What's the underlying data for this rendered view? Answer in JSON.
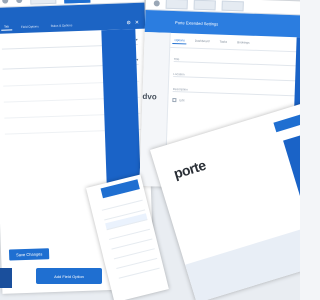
{
  "left_panel": {
    "tabs": [
      "Tab",
      "Field Options",
      "Rules & Options"
    ],
    "fields": [
      "",
      ""
    ],
    "note": "",
    "rows": [
      "",
      "",
      "",
      ""
    ],
    "action_button": "Save Changes"
  },
  "right_panel": {
    "title": "Porte Extended Settings",
    "tabs": [
      "Options",
      "Dashboard",
      "Tasks",
      "Bookings"
    ],
    "brand": "dvo",
    "fields": [
      "Title",
      "Location",
      "Description"
    ],
    "checkbox_label": "Edit"
  },
  "device": {
    "logo": "porte"
  },
  "phone": {
    "items": [
      "",
      "",
      "",
      "",
      "",
      "",
      "",
      ""
    ]
  },
  "bottom_button": {
    "label": "Add Field Option"
  },
  "colors": {
    "accent": "#1f6fd1",
    "accent_dark": "#1a63c7",
    "danger": "#d64541"
  }
}
